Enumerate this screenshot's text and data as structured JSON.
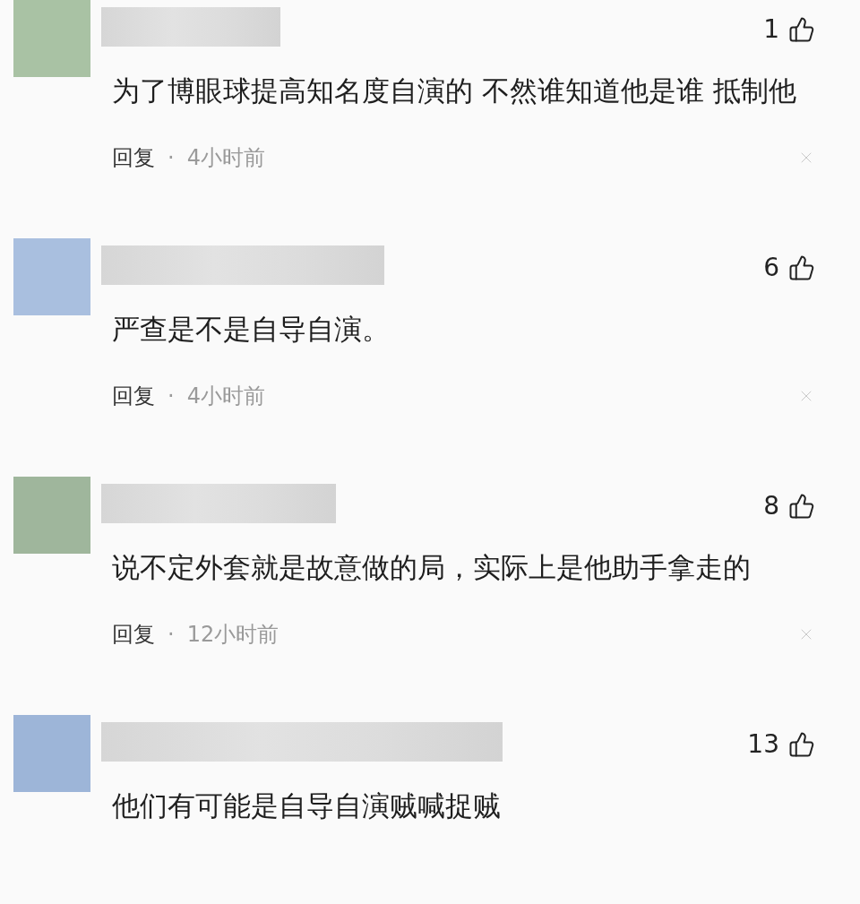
{
  "comments": [
    {
      "color": "#a9c2a4",
      "likes": "1",
      "text": "为了博眼球提高知名度自演的 不然谁知道他是谁 抵制他",
      "reply": "回复",
      "separator": "·",
      "time": "4小时前"
    },
    {
      "color": "#a9bfdf",
      "likes": "6",
      "text": "严查是不是自导自演。",
      "reply": "回复",
      "separator": "·",
      "time": "4小时前"
    },
    {
      "color": "#9fb69c",
      "likes": "8",
      "text": "说不定外套就是故意做的局，实际上是他助手拿走的",
      "reply": "回复",
      "separator": "·",
      "time": "12小时前"
    },
    {
      "color": "#9db5d8",
      "likes": "13",
      "text": "他们有可能是自导自演贼喊捉贼"
    }
  ]
}
